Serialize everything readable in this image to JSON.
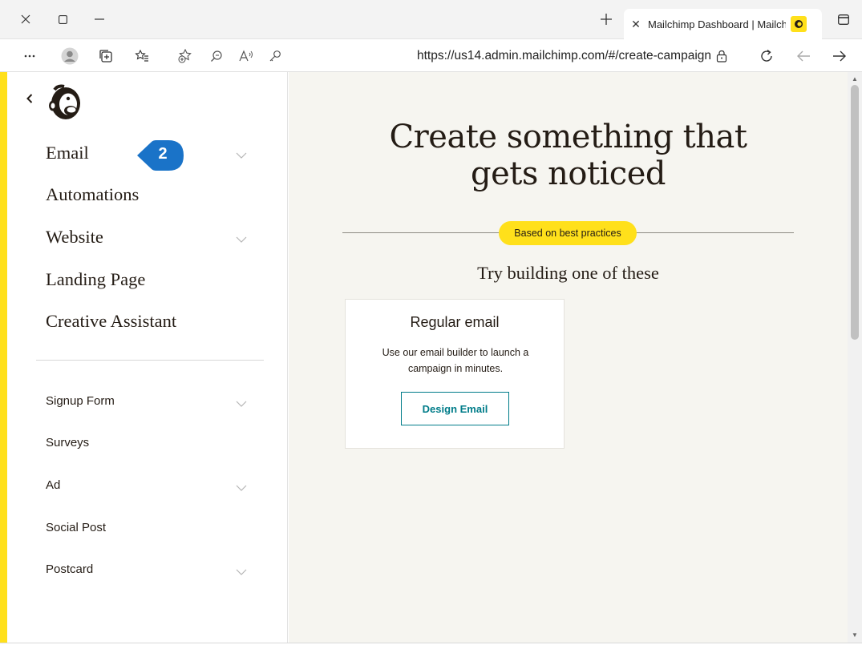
{
  "browser": {
    "tab_title": "Mailchimp Dashboard | Mailchimp",
    "url": "https://us14.admin.mailchimp.com/#/create-campaign",
    "icons": [
      "close-window-icon",
      "restore-window-icon",
      "minimize-window-icon",
      "new-tab-icon",
      "tab-close-icon",
      "mailchimp-favicon",
      "tab-actions-icon",
      "more-icon",
      "profile-icon",
      "collections-icon",
      "favorites-icon",
      "add-favorite-icon",
      "zoom-icon",
      "read-aloud-icon",
      "key-icon",
      "lock-icon",
      "refresh-icon",
      "back-arrow-icon",
      "forward-arrow-icon"
    ]
  },
  "sidebar": {
    "primary_items": [
      {
        "label": "Email",
        "has_chevron": true
      },
      {
        "label": "Automations",
        "has_chevron": false
      },
      {
        "label": "Website",
        "has_chevron": true
      },
      {
        "label": "Landing Page",
        "has_chevron": false
      },
      {
        "label": "Creative Assistant",
        "has_chevron": false
      }
    ],
    "secondary_items": [
      {
        "label": "Signup Form",
        "has_chevron": true
      },
      {
        "label": "Surveys",
        "has_chevron": false
      },
      {
        "label": "Ad",
        "has_chevron": true
      },
      {
        "label": "Social Post",
        "has_chevron": false
      },
      {
        "label": "Postcard",
        "has_chevron": true
      }
    ]
  },
  "step_marker": {
    "number": "2",
    "color": "#1a73c8"
  },
  "main": {
    "headline_line1": "Create something that",
    "headline_line2": "gets noticed",
    "pill_label": "Based on best practices",
    "subheading": "Try building one of these",
    "card": {
      "title": "Regular email",
      "description": "Use our email builder to launch a campaign in minutes.",
      "button_label": "Design Email"
    }
  },
  "colors": {
    "accent_yellow": "#ffe01b",
    "teal": "#007c89",
    "main_bg": "#f6f5f0"
  }
}
